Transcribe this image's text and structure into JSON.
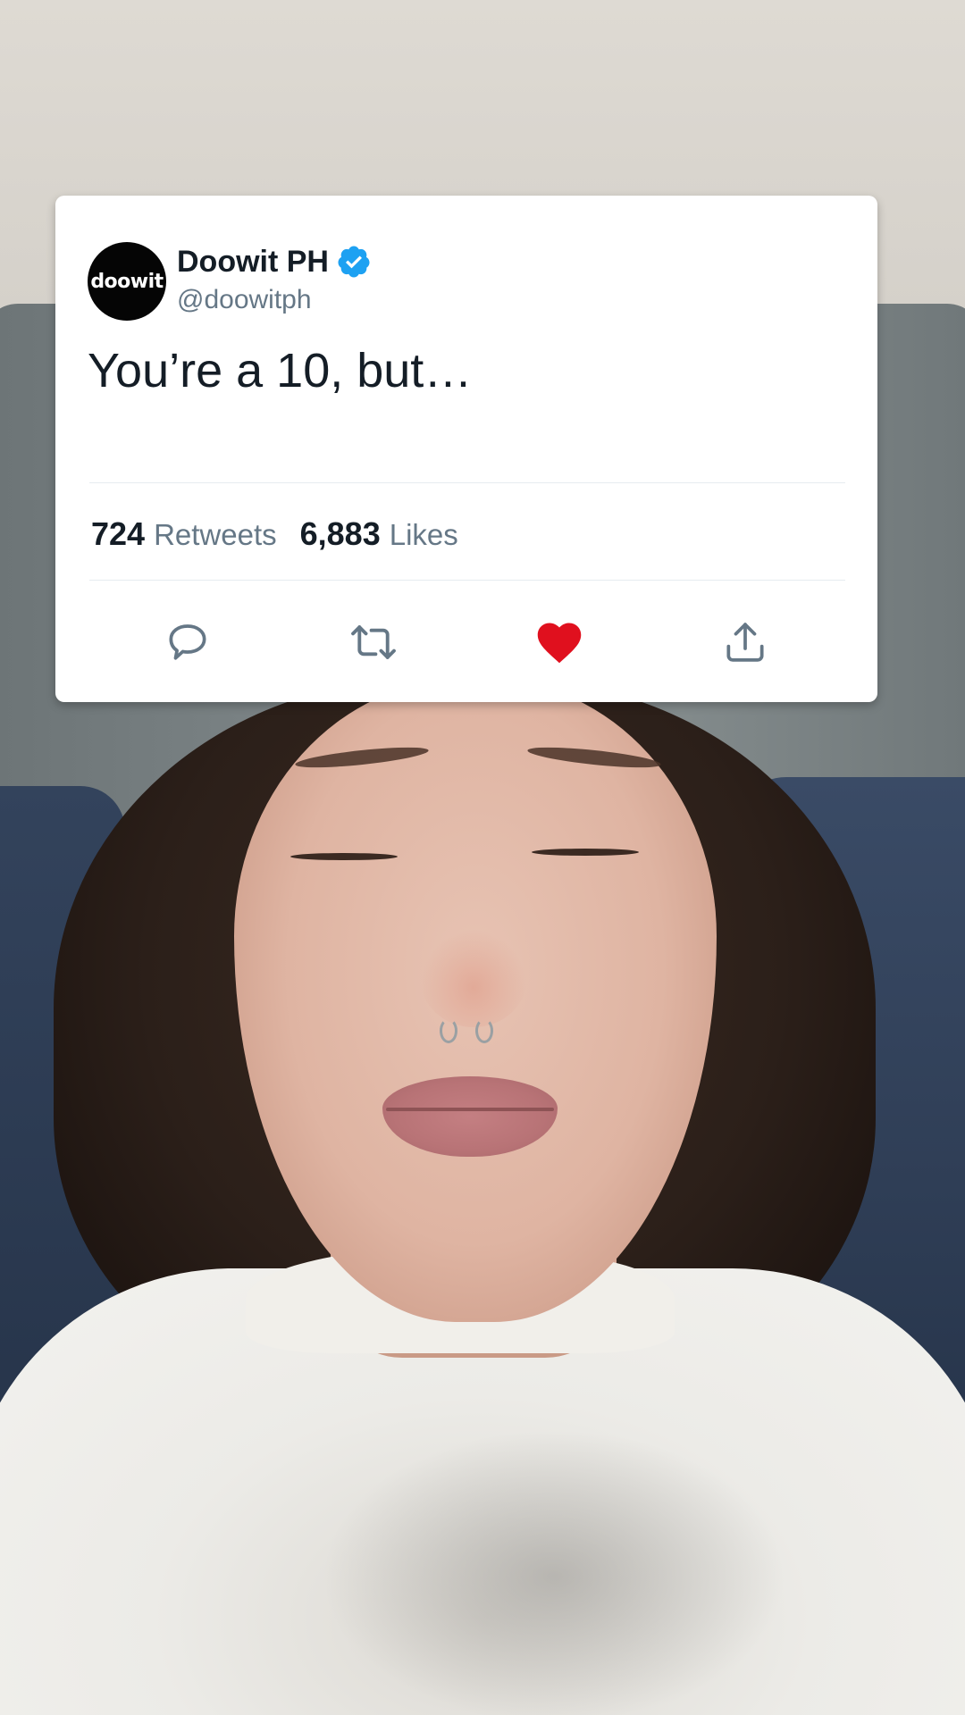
{
  "tweet": {
    "avatar_text": "doowit",
    "display_name": "Doowit PH",
    "handle": "@doowitph",
    "text": "You’re a 10, but…",
    "retweets_count": "724",
    "retweets_label": "Retweets",
    "likes_count": "6,883",
    "likes_label": "Likes",
    "verified": true,
    "liked": true
  },
  "colors": {
    "verified_badge": "#1da1f2",
    "like_heart": "#e0245e",
    "icon_gray": "#657786",
    "text_primary": "#141d26"
  },
  "icons": {
    "reply": "reply-icon",
    "retweet": "retweet-icon",
    "like": "heart-icon",
    "share": "share-icon",
    "verified": "verified-badge-icon"
  }
}
